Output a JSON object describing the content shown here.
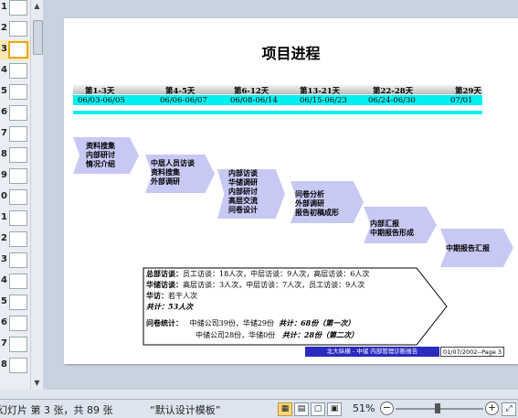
{
  "thumbnails": [
    {
      "num": "1",
      "selected": false
    },
    {
      "num": "2",
      "selected": false
    },
    {
      "num": "3",
      "selected": true
    },
    {
      "num": "4",
      "selected": false
    },
    {
      "num": "5",
      "selected": false
    },
    {
      "num": "6",
      "selected": false
    },
    {
      "num": "7",
      "selected": false
    },
    {
      "num": "8",
      "selected": false
    },
    {
      "num": "9",
      "selected": false
    },
    {
      "num": "0",
      "selected": false
    },
    {
      "num": "1",
      "selected": false
    },
    {
      "num": "2",
      "selected": false
    },
    {
      "num": "3",
      "selected": false
    },
    {
      "num": "4",
      "selected": false
    },
    {
      "num": "5",
      "selected": false
    },
    {
      "num": "6",
      "selected": false
    },
    {
      "num": "7",
      "selected": false
    },
    {
      "num": "8",
      "selected": false
    }
  ],
  "slide": {
    "title": "项目进程",
    "phases": [
      "第1-3天",
      "第4-5天",
      "第6-12天",
      "第13-21天",
      "第22-28天",
      "第29天"
    ],
    "dates": [
      "06/03-06/05",
      "06/06-06/07",
      "06/08-06/14",
      "06/15-06/23",
      "06/24-06/30",
      "07/01"
    ],
    "steps": [
      {
        "lines": [
          "资料搜集",
          "内部研讨",
          "情况介绍"
        ]
      },
      {
        "lines": [
          "中层人员访谈",
          "资料搜集",
          "外部调研"
        ]
      },
      {
        "lines": [
          "内部访谈",
          "华储调研",
          "内部研讨",
          "高层交流",
          "问卷设计"
        ]
      },
      {
        "lines": [
          "问卷分析",
          "外部调研",
          "报告初稿成形"
        ]
      },
      {
        "lines": [
          "内部汇报",
          "中期报告形成"
        ]
      },
      {
        "lines": [
          "中期报告汇报"
        ]
      }
    ],
    "summary": {
      "interview_label": "总部访谈：",
      "interview_text": "员工访谈：18人次，中层访谈：9人次，高层访谈：6人次",
      "huachu_label": "华储访谈：",
      "huachu_text": "高层访谈：3人次，中层访谈：7人次，员工访谈：9人次",
      "zhongfang_label": "华访：",
      "zhongfang_text": "若干人次",
      "total1": "共计：53人次",
      "survey_label": "问卷统计：",
      "survey_line1": "中储公司39份，华储29份",
      "survey_total1": "共计：68份（第一次）",
      "survey_line2": "中储公司28份，华储0份",
      "survey_total2": "共计：28份（第二次）"
    },
    "footer_org": "北大纵横 - 中储    内部管理诊断报告",
    "footer_page": "01/07/2002--Page 3"
  },
  "status": {
    "slide_info": "幻灯片 第 3 张，共 89 张",
    "template": "“默认设计模板”",
    "zoom": "51%"
  }
}
